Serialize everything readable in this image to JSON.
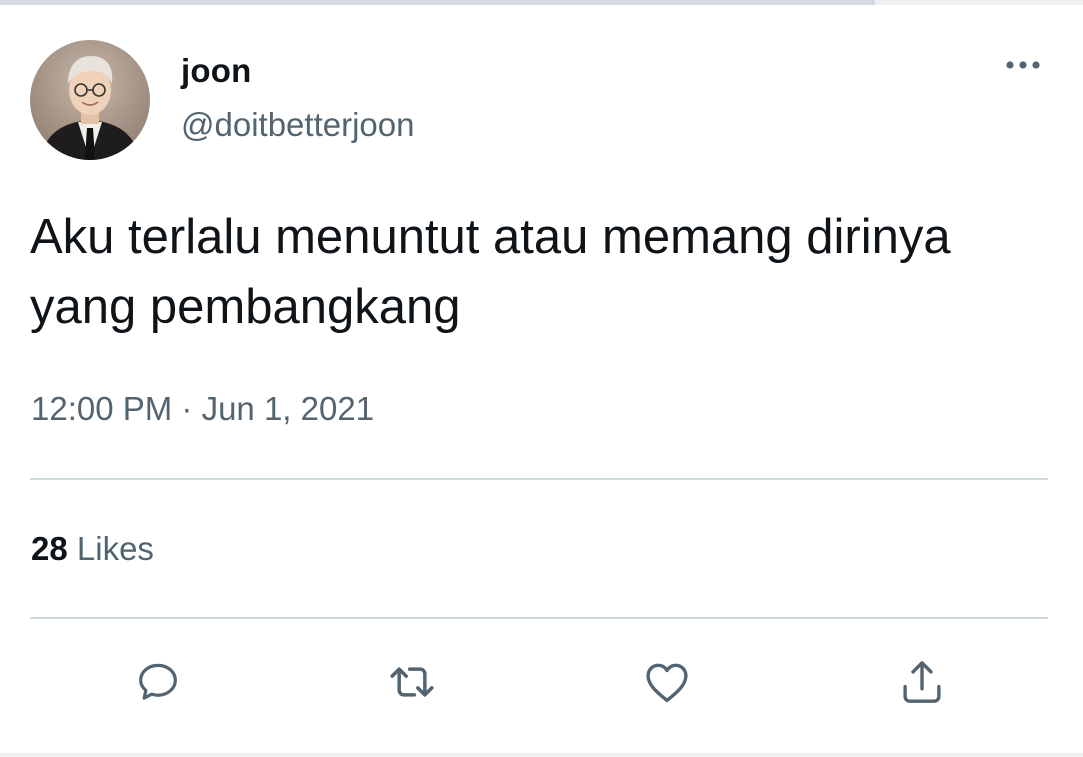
{
  "tweet": {
    "author": {
      "display_name": "joon",
      "handle": "@doitbetterjoon",
      "avatar": "profile-photo"
    },
    "text": "Aku terlalu menuntut atau memang dirinya yang pembangkang",
    "timestamp": "12:00 PM · Jun 1, 2021",
    "likes": {
      "count": "28",
      "label": "Likes"
    }
  },
  "icons": {
    "more": "more-options-icon",
    "reply": "reply-icon",
    "retweet": "retweet-icon",
    "like": "heart-icon",
    "share": "share-icon"
  },
  "colors": {
    "primary_text": "#0f1419",
    "secondary_text": "#536471",
    "divider": "#cfd9de",
    "icon": "#536471"
  }
}
